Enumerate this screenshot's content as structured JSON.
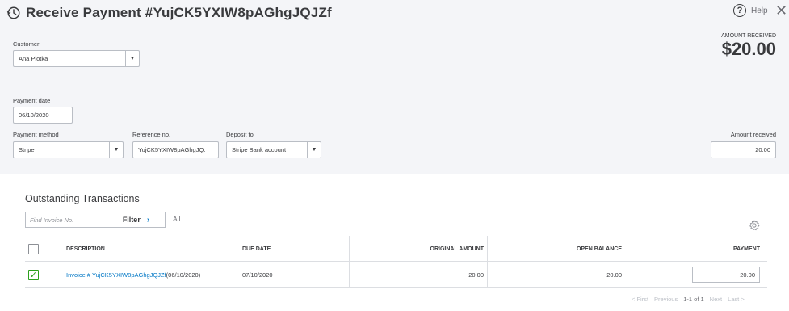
{
  "header": {
    "title": "Receive Payment #YujCK5YXIW8pAGhgJQJZf",
    "help_label": "Help",
    "close_glyph": "✕"
  },
  "form": {
    "customer_label": "Customer",
    "customer_value": "Ana Plotka",
    "payment_date_label": "Payment date",
    "payment_date_value": "06/10/2020",
    "payment_method_label": "Payment method",
    "payment_method_value": "Stripe",
    "reference_label": "Reference no.",
    "reference_value": "YujCK5YXIW8pAGhgJQ.",
    "deposit_label": "Deposit to",
    "deposit_value": "Stripe Bank account",
    "amount_received_label": "Amount received",
    "amount_received_value": "20.00"
  },
  "summary": {
    "caption": "AMOUNT RECEIVED",
    "amount": "$20.00"
  },
  "transactions": {
    "title": "Outstanding Transactions",
    "find_placeholder": "Find Invoice No.",
    "filter_label": "Filter",
    "all_label": "All",
    "columns": [
      "DESCRIPTION",
      "DUE DATE",
      "ORIGINAL AMOUNT",
      "OPEN BALANCE",
      "PAYMENT"
    ],
    "rows": [
      {
        "checked": true,
        "invoice_link": "Invoice # YujCK5YXIW8pAGhgJQJZf",
        "invoice_date": " (06/10/2020)",
        "due_date": "07/10/2020",
        "original_amount": "20.00",
        "open_balance": "20.00",
        "payment": "20.00"
      }
    ]
  },
  "pagination": {
    "first": "< First",
    "previous": "Previous",
    "range": "1-1 of 1",
    "next": "Next",
    "last": "Last >"
  },
  "colors": {
    "header_bg": "#f4f5f8",
    "link": "#0077c5",
    "check": "#2ca01c"
  },
  "icons": [
    "history-icon",
    "help-icon",
    "close-icon",
    "chevron-down-icon",
    "chevron-right-icon",
    "gear-icon",
    "checkmark-icon"
  ]
}
